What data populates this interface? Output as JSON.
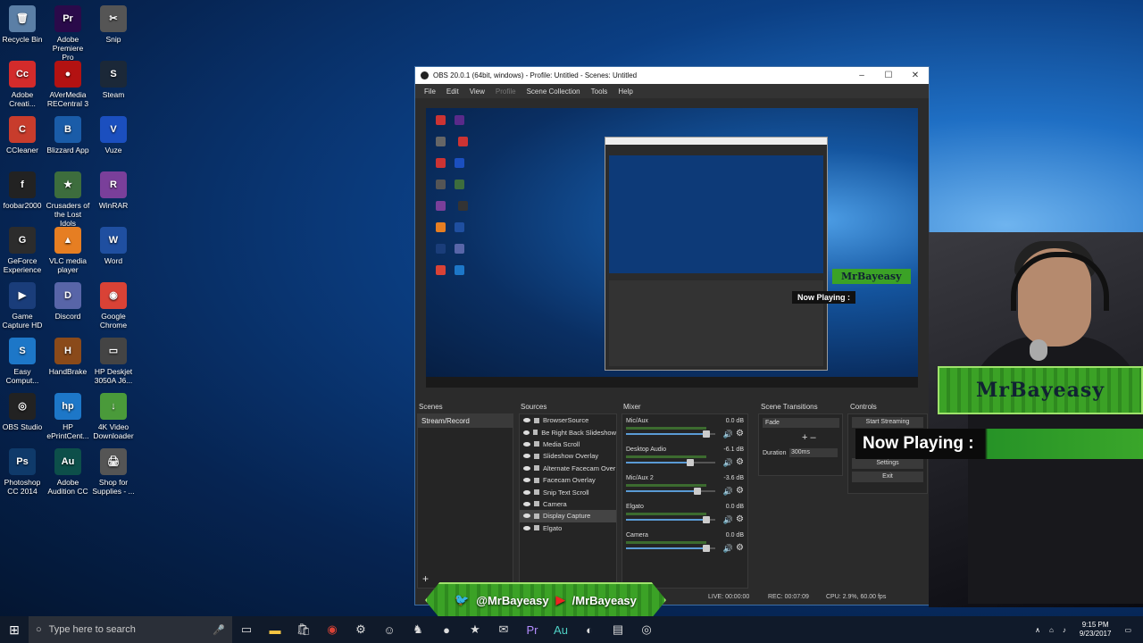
{
  "desktop_icons": [
    {
      "label": "Recycle Bin",
      "glyph": "🗑",
      "color": "#5b7fa6"
    },
    {
      "label": "Adobe Premiere Pro",
      "glyph": "Pr",
      "color": "#2a0a4a"
    },
    {
      "label": "Snip",
      "glyph": "✂",
      "color": "#555"
    },
    {
      "label": "Adobe Creati...",
      "glyph": "Cc",
      "color": "#d32b2b"
    },
    {
      "label": "AVerMedia RECentral 3",
      "glyph": "●",
      "color": "#b31212"
    },
    {
      "label": "Steam",
      "glyph": "S",
      "color": "#1b2838"
    },
    {
      "label": "CCleaner",
      "glyph": "C",
      "color": "#c83c2c"
    },
    {
      "label": "Blizzard App",
      "glyph": "B",
      "color": "#1a5ca8"
    },
    {
      "label": "Vuze",
      "glyph": "V",
      "color": "#1b4fbf"
    },
    {
      "label": "foobar2000",
      "glyph": "f",
      "color": "#222"
    },
    {
      "label": "Crusaders of the Lost Idols",
      "glyph": "★",
      "color": "#3d6d3d"
    },
    {
      "label": "WinRAR",
      "glyph": "R",
      "color": "#7a3f9a"
    },
    {
      "label": "GeForce Experience",
      "glyph": "G",
      "color": "#2c2c2c"
    },
    {
      "label": "VLC media player",
      "glyph": "▲",
      "color": "#e67e22"
    },
    {
      "label": "Word",
      "glyph": "W",
      "color": "#1f4fa0"
    },
    {
      "label": "Game Capture HD",
      "glyph": "▶",
      "color": "#1a3d7a"
    },
    {
      "label": "Discord",
      "glyph": "D",
      "color": "#5865a8"
    },
    {
      "label": "Google Chrome",
      "glyph": "◉",
      "color": "#d94236"
    },
    {
      "label": "Easy Comput...",
      "glyph": "S",
      "color": "#1d77c8"
    },
    {
      "label": "HandBrake",
      "glyph": "H",
      "color": "#8a4a1a"
    },
    {
      "label": "HP Deskjet 3050A J6...",
      "glyph": "▭",
      "color": "#444"
    },
    {
      "label": "OBS Studio",
      "glyph": "◎",
      "color": "#222"
    },
    {
      "label": "HP ePrintCent...",
      "glyph": "hp",
      "color": "#1d77c8"
    },
    {
      "label": "4K Video Downloader",
      "glyph": "↓",
      "color": "#4a9a3a"
    },
    {
      "label": "Photoshop CC 2014",
      "glyph": "Ps",
      "color": "#0f3a6a"
    },
    {
      "label": "Adobe Audition CC",
      "glyph": "Au",
      "color": "#0d4f4a"
    },
    {
      "label": "Shop for Supplies - ...",
      "glyph": "🖨",
      "color": "#555"
    }
  ],
  "obs": {
    "title": "OBS 20.0.1 (64bit, windows) - Profile: Untitled - Scenes: Untitled",
    "window_buttons": [
      "–",
      "☐",
      "✕"
    ],
    "menu": [
      "File",
      "Edit",
      "View",
      "Profile",
      "Scene Collection",
      "Tools",
      "Help"
    ],
    "preview_overlay_now_playing": "Now Playing :",
    "preview_overlay_name": "MrBayeasy",
    "panels": {
      "scenes": "Scenes",
      "sources": "Sources",
      "mixer": "Mixer",
      "transitions": "Scene Transitions",
      "controls": "Controls"
    },
    "scenes": [
      "Stream/Record"
    ],
    "sources": [
      "BrowserSource",
      "Be Right Back Slideshow",
      "Media Scroll",
      "Slideshow Overlay",
      "Alternate Facecam Over",
      "Facecam Overlay",
      "Snip Text Scroll",
      "Camera",
      "Display Capture",
      "Elgato"
    ],
    "mixer": [
      {
        "name": "Mic/Aux",
        "db": "0.0 dB",
        "level": 0.9
      },
      {
        "name": "Desktop Audio",
        "db": "-6.1 dB",
        "level": 0.72
      },
      {
        "name": "Mic/Aux 2",
        "db": "-3.6 dB",
        "level": 0.8
      },
      {
        "name": "Elgato",
        "db": "0.0 dB",
        "level": 0.9
      },
      {
        "name": "Camera",
        "db": "0.0 dB",
        "level": 0.9
      }
    ],
    "transition": {
      "value": "Fade",
      "duration_label": "Duration",
      "duration": "300ms"
    },
    "controls": [
      "Start Streaming",
      "Settings",
      "Exit"
    ],
    "status": {
      "live": "LIVE: 00:00:00",
      "rec": "REC: 00:07:09",
      "cpu": "CPU: 2.9%, 60.00 fps"
    }
  },
  "overlays": {
    "banner": "MrBayeasy",
    "now_playing": "Now Playing :",
    "social_twitter": "@MrBayeasy",
    "social_youtube": "/MrBayeasy"
  },
  "taskbar": {
    "search_placeholder": "Type here to search",
    "time": "9:15 PM",
    "date": "9/23/2017"
  }
}
